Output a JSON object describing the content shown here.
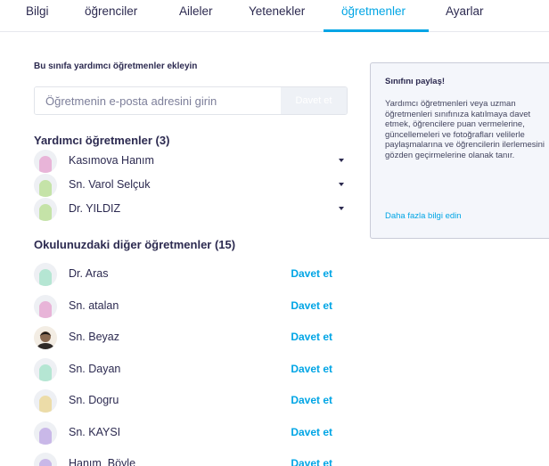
{
  "tabs": [
    {
      "label": "Bilgi",
      "active": false
    },
    {
      "label": "öğrenciler",
      "active": false
    },
    {
      "label": "Aileler",
      "active": false
    },
    {
      "label": "Yetenekler",
      "active": false
    },
    {
      "label": "öğretmenler",
      "active": true
    },
    {
      "label": "Ayarlar",
      "active": false
    }
  ],
  "invite": {
    "title": "Bu sınıfa yardımcı öğretmenler ekleyin",
    "placeholder": "Öğretmenin e-posta adresini girin",
    "button_label": "Davet et"
  },
  "co_teachers": {
    "heading": "Yardımcı öğretmenler (3)",
    "items": [
      {
        "name": "Kasımova Hanım",
        "avatar_color": "#e8b4d8"
      },
      {
        "name": "Sn. Varol Selçuk",
        "avatar_color": "#c5e3a8"
      },
      {
        "name": "Dr. YILDIZ",
        "avatar_color": "#c5e3a8"
      }
    ]
  },
  "school_teachers": {
    "heading": "Okulunuzdaki diğer öğretmenler (15)",
    "invite_label": "Davet et",
    "items": [
      {
        "name": "Dr. Aras",
        "avatar_color": "#b5e6d3",
        "photo": false
      },
      {
        "name": "Sn. atalan",
        "avatar_color": "#e8b4d8",
        "photo": false
      },
      {
        "name": "Sn. Beyaz",
        "avatar_color": "#5a4a3e",
        "photo": true
      },
      {
        "name": "Sn. Dayan",
        "avatar_color": "#b5e6d3",
        "photo": false
      },
      {
        "name": "Sn. Dogru",
        "avatar_color": "#ecdca8",
        "photo": false
      },
      {
        "name": "Sn. KAYSI",
        "avatar_color": "#c9b8e8",
        "photo": false
      },
      {
        "name": "Hanım_Böyle",
        "avatar_color": "#c9b8e8",
        "photo": false
      }
    ]
  },
  "share_card": {
    "title": "Sınıfını paylaş!",
    "text": "Yardımcı öğretmenleri veya uzman öğretmenleri sınıfınıza katılmaya davet etmek, öğrencilere puan vermelerine, güncellemeleri ve fotoğrafları velilerle paylaşmalarına ve öğrencilerin ilerlemesini gözden geçirmelerine olanak tanır.",
    "link": "Daha fazla bilgi edin"
  },
  "colors": {
    "accent": "#00a5e5",
    "text": "#2c2a50",
    "card_bg": "#f4f6fb"
  }
}
